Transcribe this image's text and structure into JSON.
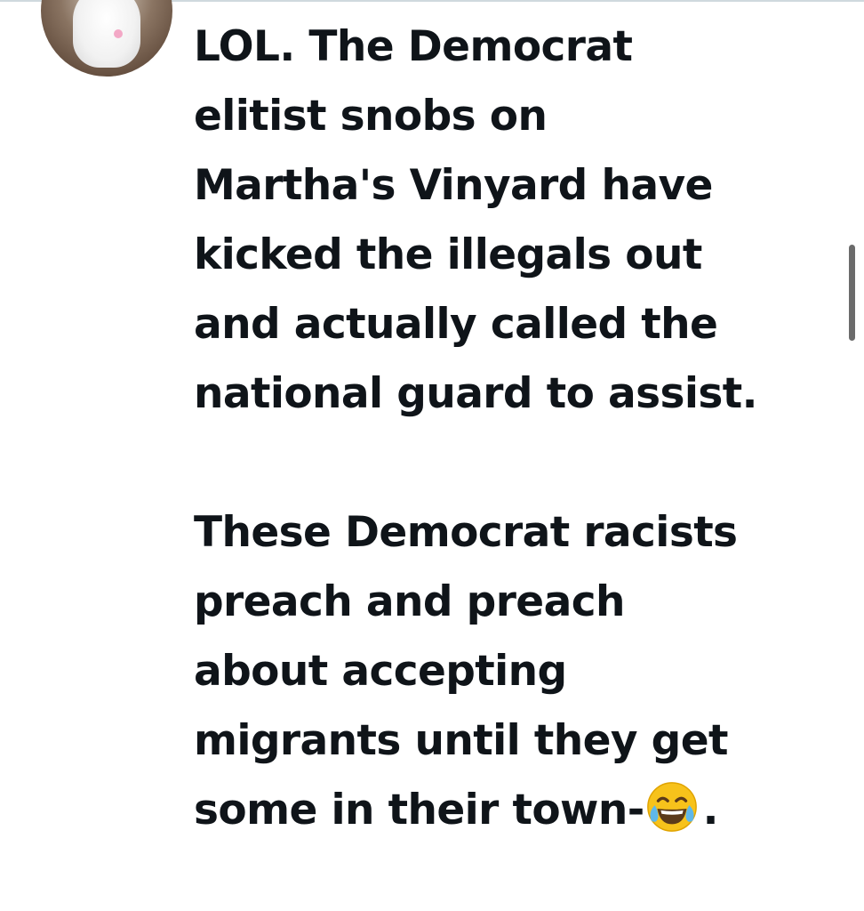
{
  "tweet": {
    "lines_para1": [
      "LOL.  The Democrat",
      "elitist snobs on",
      "Martha's Vinyard have",
      "kicked the illegals out",
      "and actually called the",
      "national guard to assist."
    ],
    "lines_para2": [
      "These Democrat racists",
      "preach and preach",
      "about accepting",
      "migrants until they get"
    ],
    "last_line_text": "some in their town-",
    "last_line_suffix": ".",
    "emoji_name": "face-with-tears-of-joy-icon"
  },
  "colors": {
    "text": "#0f1419",
    "background": "#ffffff",
    "scrollbar": "#6b6b6b"
  }
}
